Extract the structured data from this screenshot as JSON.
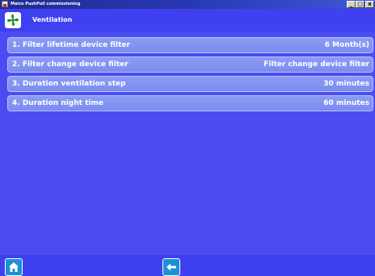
{
  "window": {
    "title": "Maico PushPull commissioning",
    "controls": {
      "minimize": "_",
      "maximize": "□",
      "close": "x"
    }
  },
  "header": {
    "title": "Ventilation",
    "icon": "fan-icon"
  },
  "items": [
    {
      "label": "1. Filter lifetime device filter",
      "value": "6 Month(s)"
    },
    {
      "label": "2. Filter change device filter",
      "value": "Filter change device filter"
    },
    {
      "label": "3. Duration ventilation step",
      "value": "30 minutes"
    },
    {
      "label": "4. Duration night time",
      "value": "60 minutes"
    }
  ],
  "footer": {
    "home_icon": "home-icon",
    "back_icon": "arrow-left-icon"
  },
  "colors": {
    "background": "#4a4cf2",
    "row": "#8c9cf3",
    "button": "#1a90d8",
    "fan_icon": "#2a8a3a"
  }
}
